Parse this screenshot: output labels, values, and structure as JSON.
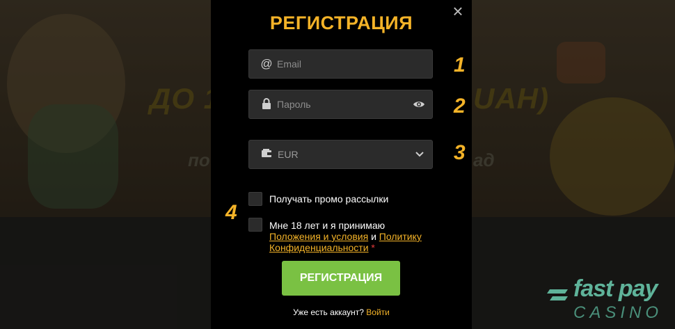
{
  "background": {
    "headline": "ДО 1",
    "headline_right": "UAH)",
    "subline_left": "по",
    "subline_right": "ад"
  },
  "logo": {
    "fast": "fast pay",
    "casino": "CASINO"
  },
  "modal": {
    "title": "РЕГИСТРАЦИЯ",
    "close_glyph": "×",
    "email": {
      "placeholder": "Email",
      "icon": "at-icon"
    },
    "password": {
      "placeholder": "Пароль",
      "icon": "lock-icon"
    },
    "currency": {
      "value": "EUR",
      "icon": "wallet-icon"
    },
    "promo_label": "Получать промо рассылки",
    "terms": {
      "prefix": "Мне 18 лет и я принимаю",
      "link1": "Положения и условия",
      "and": " и ",
      "link2_a": "Политику",
      "link2_b": "Конфиденциальности",
      "required": " *"
    },
    "submit_label": "РЕГИСТРАЦИЯ",
    "login_prompt": "Уже есть аккаунт?",
    "login_link": "Войти"
  },
  "annotations": [
    "1",
    "2",
    "3",
    "4"
  ],
  "colors": {
    "accent": "#f4b328",
    "button": "#7ac143",
    "modal_bg": "#000000"
  }
}
